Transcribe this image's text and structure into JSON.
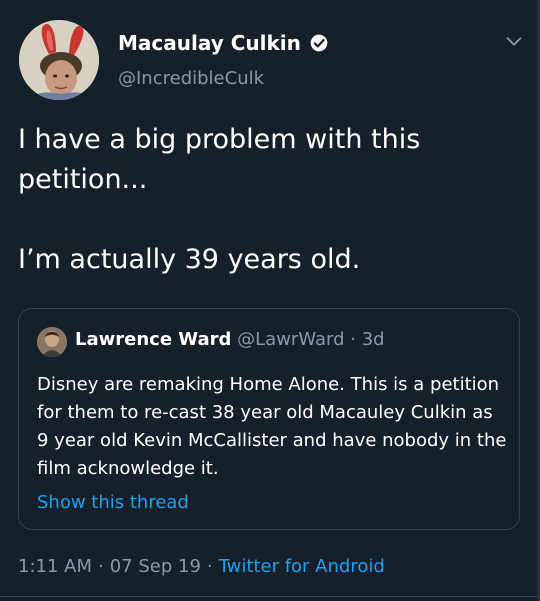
{
  "author": {
    "name": "Macaulay Culkin",
    "handle": "@IncredibleCulk",
    "verified": true
  },
  "tweet": {
    "paragraphs": [
      "I have a big problem with this petition...",
      "I’m actually 39 years old."
    ]
  },
  "quoted_tweet": {
    "author_name": "Lawrence Ward",
    "author_handle": "@LawrWard",
    "separator": " · ",
    "age": "3d",
    "text": "Disney are remaking Home Alone. This is a petition for them to re-cast 38 year old Macauley Culkin as 9 year old Kevin McCallister and have nobody in the film acknowledge it.",
    "show_thread_label": "Show this thread"
  },
  "footer": {
    "time": "1:11 AM",
    "date": "07 Sep 19",
    "source": "Twitter for Android",
    "separator": "·"
  },
  "colors": {
    "background": "#15202b",
    "text": "#ffffff",
    "secondary_text": "#8899a6",
    "link": "#1da1f2",
    "border": "#38444d"
  },
  "icons": {
    "verified": "verified-badge-icon",
    "menu": "chevron-down-icon"
  }
}
